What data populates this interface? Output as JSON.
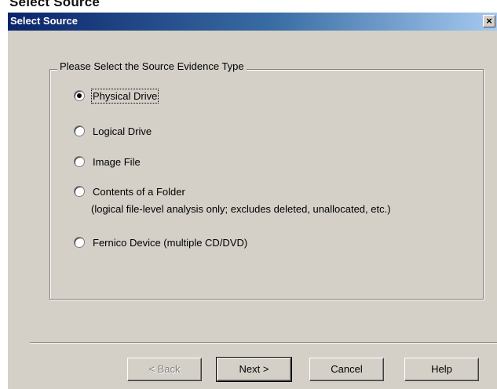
{
  "page_caption": "Select Source",
  "dialog": {
    "title": "Select Source",
    "close_glyph": "×"
  },
  "group": {
    "legend": "Please Select the Source Evidence Type",
    "options": [
      {
        "label": "Physical Drive",
        "checked": true
      },
      {
        "label": "Logical Drive",
        "checked": false
      },
      {
        "label": "Image File",
        "checked": false
      },
      {
        "label": "Contents of a Folder",
        "checked": false
      },
      {
        "label": "Fernico Device (multiple CD/DVD)",
        "checked": false
      }
    ],
    "folder_note": "(logical file-level analysis only; excludes deleted, unallocated, etc.)"
  },
  "buttons": {
    "back": "< Back",
    "next": "Next >",
    "cancel": "Cancel",
    "help": "Help"
  }
}
